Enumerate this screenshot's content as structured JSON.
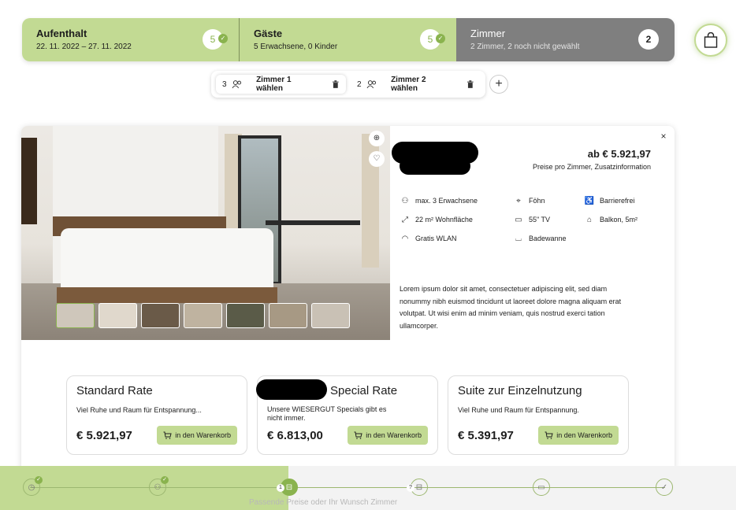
{
  "steps": [
    {
      "title": "Aufenthalt",
      "sub": "22. 11. 2022 – 27. 11. 2022",
      "count": "5",
      "check": "✓"
    },
    {
      "title": "Gäste",
      "sub": "5 Erwachsene, 0 Kinder",
      "count": "5",
      "check": "✓"
    },
    {
      "title": "Zimmer",
      "sub": "2 Zimmer, 2 noch nicht gewählt",
      "count": "2"
    }
  ],
  "room_select": [
    {
      "num": "3",
      "label": "Zimmer 1 wählen"
    },
    {
      "num": "2",
      "label": "Zimmer 2 wählen"
    }
  ],
  "add_room_label": "+",
  "room": {
    "price_from": "ab € 5.921,97",
    "price_note": "Preise pro Zimmer, Zusatzinformation",
    "close": "×",
    "amenities": [
      {
        "icon": "guests-icon",
        "glyph": "⚇",
        "label": "max. 3 Erwachsene"
      },
      {
        "icon": "hairdryer-icon",
        "glyph": "⌖",
        "label": "Föhn"
      },
      {
        "icon": "accessible-icon",
        "glyph": "♿",
        "label": "Barrierefrei"
      },
      {
        "icon": "area-icon",
        "glyph": "⤢",
        "label": "22 m² Wohnfläche"
      },
      {
        "icon": "tv-icon",
        "glyph": "▭",
        "label": "55\" TV"
      },
      {
        "icon": "balcony-icon",
        "glyph": "⌂",
        "label": "Balkon, 5m²"
      },
      {
        "icon": "wifi-icon",
        "glyph": "◠",
        "label": "Gratis WLAN"
      },
      {
        "icon": "bathtub-icon",
        "glyph": "⌴",
        "label": "Badewanne"
      }
    ],
    "description": "Lorem ipsum dolor sit amet, consectetuer adipiscing elit, sed diam nonummy nibh euismod tincidunt ut laoreet dolore magna aliquam erat volutpat. Ut wisi enim ad minim veniam, quis nostrud exerci tation ullamcorper."
  },
  "rates": [
    {
      "title": "Standard Rate",
      "sub": "Viel Ruhe und Raum für Entspannung...",
      "price": "€ 5.921,97",
      "button": "in den Warenkorb"
    },
    {
      "title": "Special Rate",
      "sub": "Unsere WIESERGUT Specials gibt es nicht immer.",
      "price": "€ 6.813,00",
      "button": "in den Warenkorb"
    },
    {
      "title": "Suite zur Einzelnutzung",
      "sub": "Viel Ruhe und Raum für Entspannung.",
      "price": "€ 5.391,97",
      "button": "in den Warenkorb"
    }
  ],
  "progress": {
    "fraction": 0.39,
    "active_number": "1",
    "pending_badge": "?"
  },
  "footer_faint": "Passende Preise oder Ihr Wunsch Zimmer",
  "colors": {
    "accent": "#c2da93",
    "accent_dark": "#8ab34e",
    "step_inactive": "#7f7f7f"
  }
}
